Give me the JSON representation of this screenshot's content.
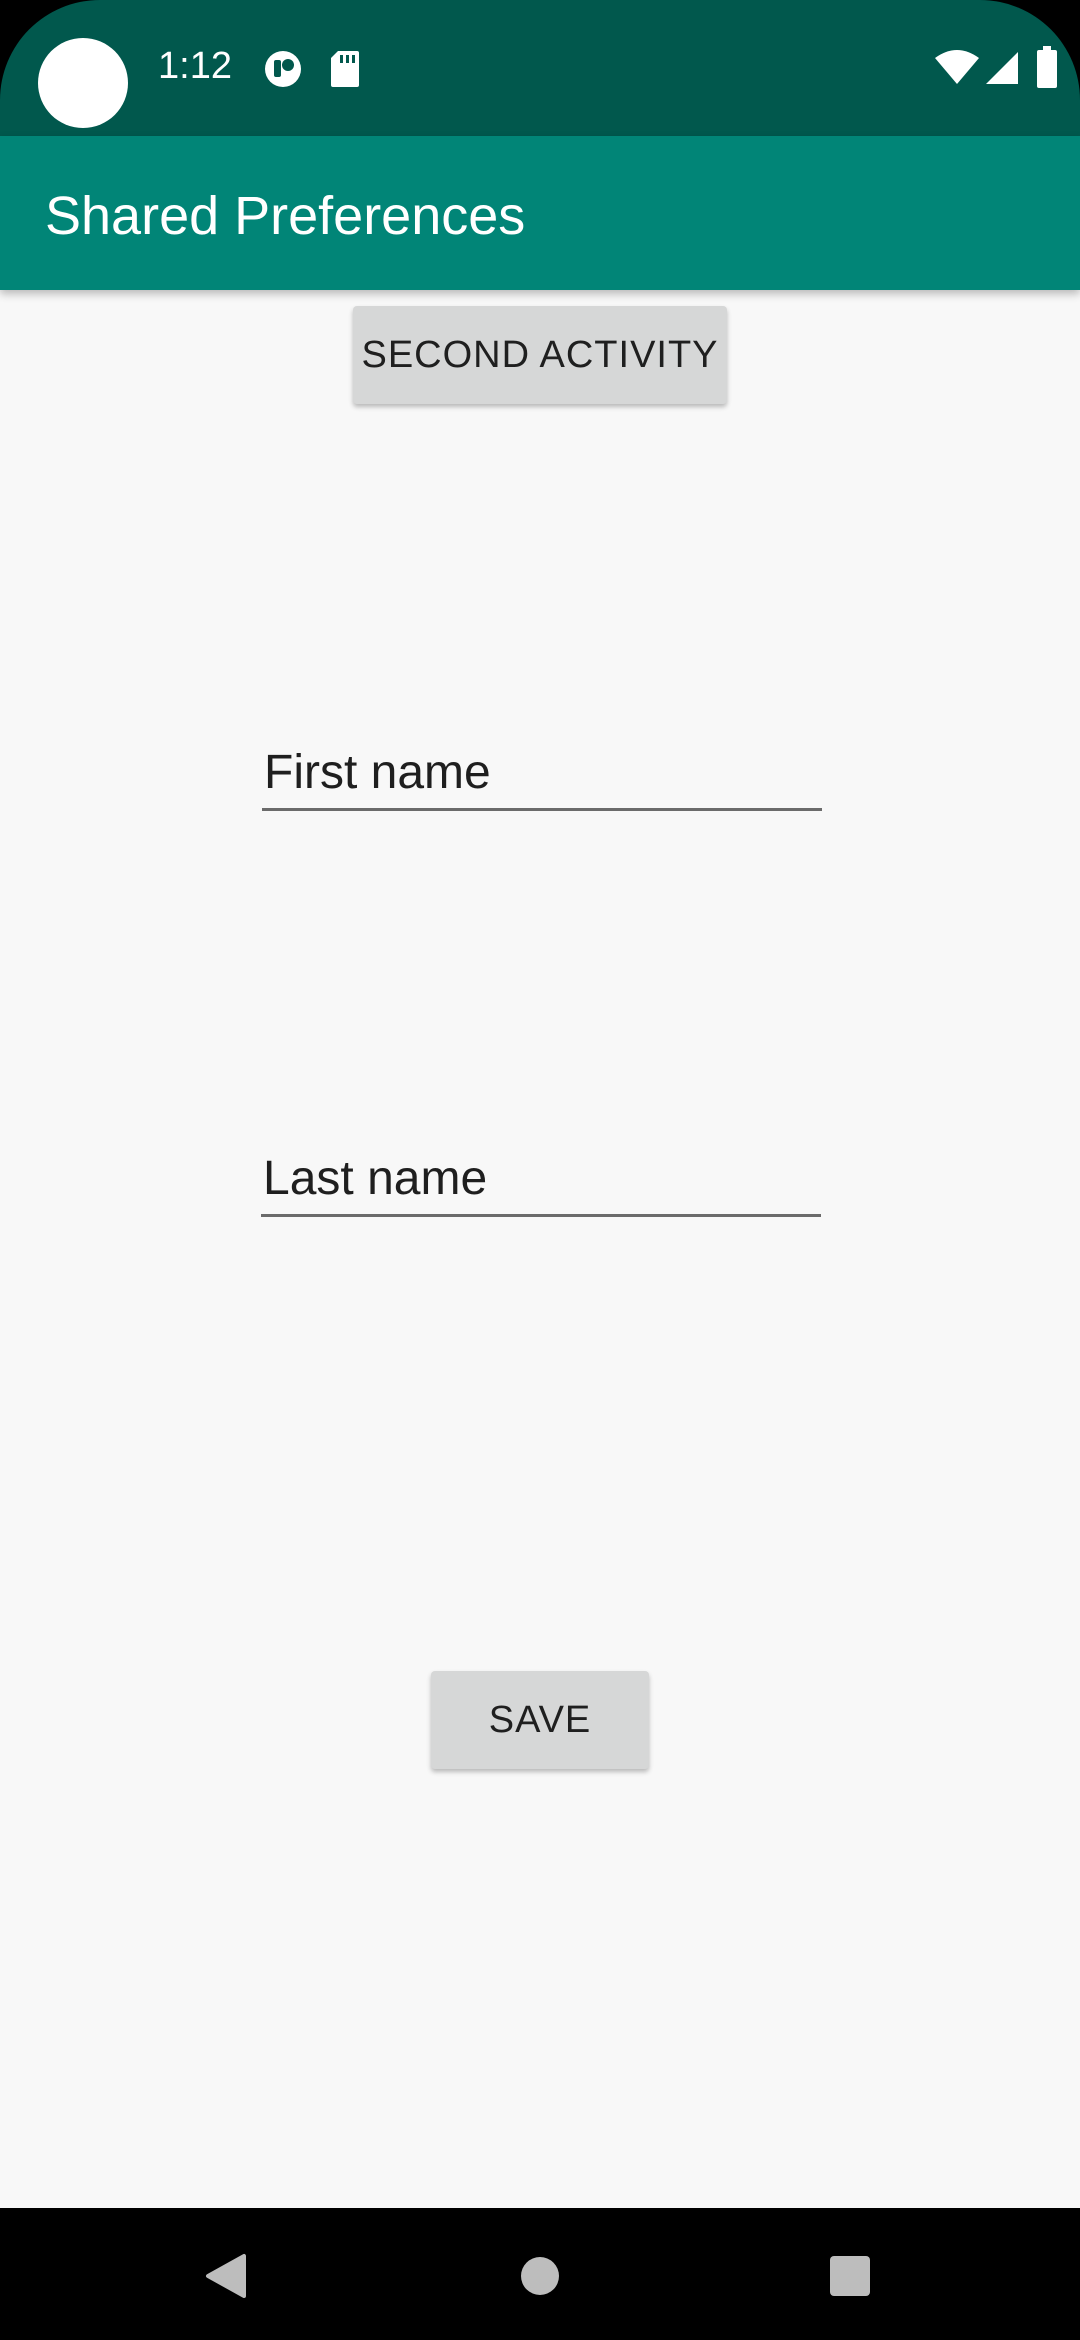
{
  "status_bar": {
    "time": "1:12",
    "background": "#01584D",
    "icons": [
      "camera-cutout",
      "notification-app-icon",
      "sd-card-icon",
      "wifi-icon",
      "signal-icon",
      "battery-icon"
    ]
  },
  "app_bar": {
    "title": "Shared Preferences",
    "background": "#018577"
  },
  "main": {
    "second_activity_label": "SECOND ACTIVITY",
    "first_name_placeholder": "First name",
    "last_name_placeholder": "Last name",
    "save_label": "SAVE",
    "background": "#F8F8F8"
  },
  "nav_bar": {
    "icons": [
      "back-icon",
      "home-icon",
      "recents-icon"
    ]
  }
}
